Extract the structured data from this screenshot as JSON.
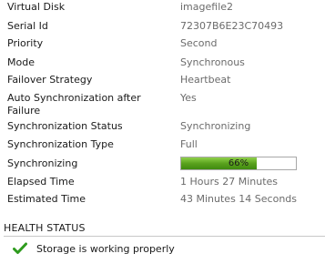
{
  "properties": [
    {
      "label": "Virtual Disk",
      "value": "imagefile2"
    },
    {
      "label": "Serial Id",
      "value": "72307B6E23C70493"
    },
    {
      "label": "Priority",
      "value": "Second"
    },
    {
      "label": "Mode",
      "value": "Synchronous"
    },
    {
      "label": "Failover Strategy",
      "value": "Heartbeat"
    },
    {
      "label": "Auto Synchronization after Failure",
      "value": "Yes"
    },
    {
      "label": "Synchronization Status",
      "value": "Synchronizing"
    },
    {
      "label": "Synchronization Type",
      "value": "Full"
    },
    {
      "label": "Synchronizing",
      "progress": 0.66,
      "progress_text": "66%"
    },
    {
      "label": "Elapsed Time",
      "value": "1 Hours 27 Minutes"
    },
    {
      "label": "Estimated Time",
      "value": "43 Minutes 14 Seconds"
    }
  ],
  "health": {
    "title": "HEALTH STATUS",
    "status_text": "Storage is working properly",
    "status_icon": "green-check-icon"
  },
  "colors": {
    "progress_fill": "#5aa21d",
    "check": "#2e9b1e",
    "value_text": "#6b6b6b"
  }
}
